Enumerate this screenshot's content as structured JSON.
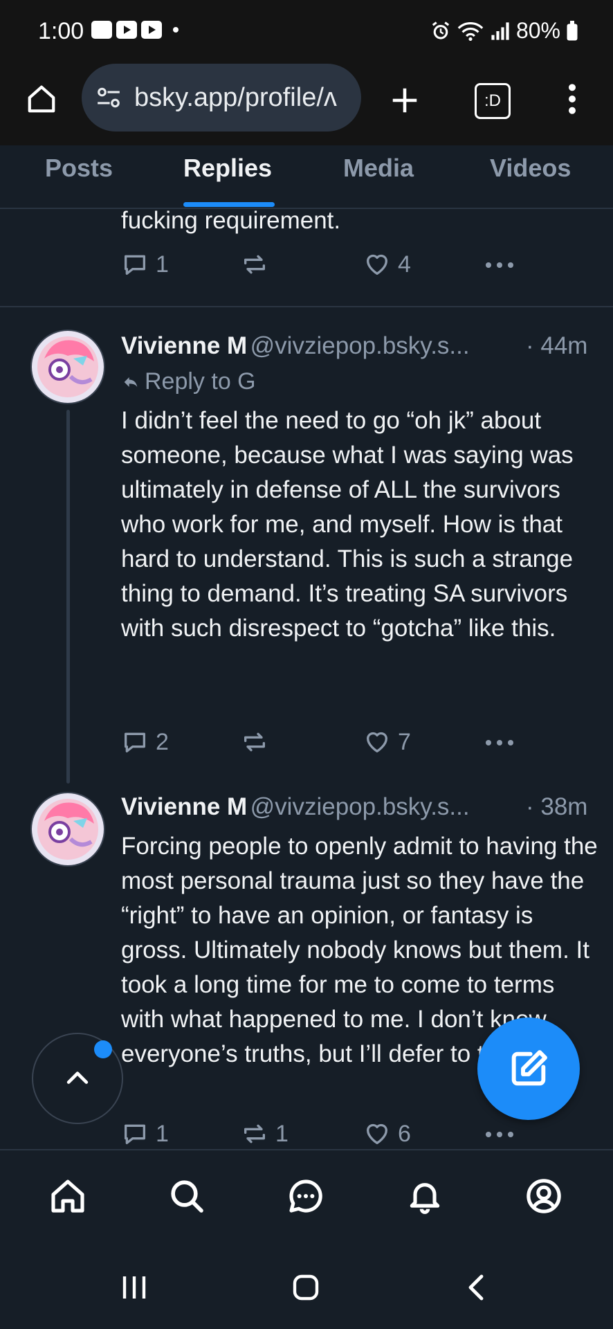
{
  "status_bar": {
    "time": "1:00",
    "battery": "80%"
  },
  "browser": {
    "url": "bsky.app/profile/ʌ",
    "tab_count": ":D"
  },
  "tabs": [
    {
      "label": "Posts"
    },
    {
      "label": "Replies"
    },
    {
      "label": "Media"
    },
    {
      "label": "Videos"
    }
  ],
  "posts": [
    {
      "text": "fucking requirement.",
      "replies": "1",
      "reposts": "",
      "likes": "4"
    },
    {
      "author": "Vivienne M",
      "handle": "@vivziepop.bsky.s...",
      "time": "· 44m",
      "reply_to": "Reply to G",
      "text": "I didn’t feel the need to go “oh jk” about someone, because what I was saying was ultimately in defense of ALL the survivors who work for me, and myself. How is that hard to understand. This is such a strange thing to demand. It’s treating SA survivors with such disrespect to “gotcha” like this.",
      "replies": "2",
      "reposts": "",
      "likes": "7"
    },
    {
      "author": "Vivienne M",
      "handle": "@vivziepop.bsky.s...",
      "time": "· 38m",
      "text": "Forcing people to openly admit to having the most personal trauma just so they have the “right” to have an opinion, or fantasy is gross. Ultimately nobody knows but them. It took a long time for me to come to terms with what happened to me. I don’t know everyone’s truths, but I’ll defer to them.",
      "replies": "1",
      "reposts": "1",
      "likes": "6"
    }
  ],
  "colors": {
    "accent": "#1c8cf9",
    "background": "#161e27",
    "muted": "#8d9aab"
  }
}
